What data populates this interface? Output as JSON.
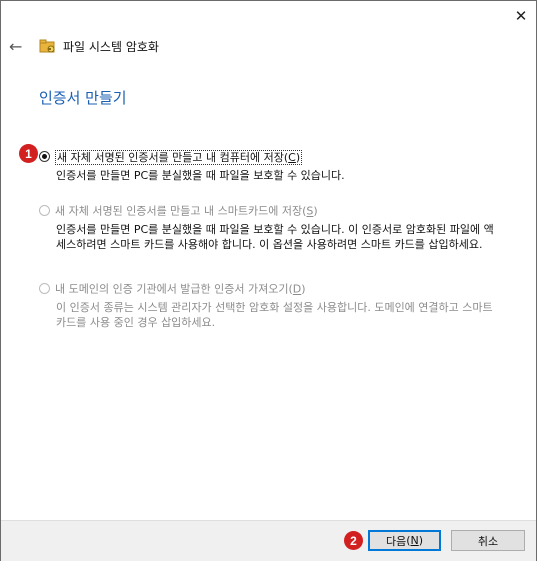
{
  "window": {
    "title": "파일 시스템 암호화"
  },
  "header": {
    "page_heading": "인증서 만들기"
  },
  "options": [
    {
      "label": "새 자체 서명된 인증서를 만들고 내 컴퓨터에 저장",
      "mnemonic": "C",
      "description": "인증서를 만들면 PC를 분실했을 때 파일을 보호할 수 있습니다.",
      "selected": true,
      "enabled": true
    },
    {
      "label": "새 자체 서명된 인증서를 만들고 내 스마트카드에 저장",
      "mnemonic": "S",
      "description": "인증서를 만들면 PC를 분실했을 때 파일을 보호할 수 있습니다. 이 인증서로 암호화된 파일에 액세스하려면 스마트 카드를 사용해야 합니다. 이 옵션을 사용하려면 스마트 카드를 삽입하세요.",
      "selected": false,
      "enabled": false
    },
    {
      "label": "내 도메인의 인증 기관에서 발급한 인증서 가져오기",
      "mnemonic": "D",
      "description": "이 인증서 종류는 시스템 관리자가 선택한 암호화 설정을 사용합니다. 도메인에 연결하고 스마트 카드를 사용 중인 경우 삽입하세요.",
      "selected": false,
      "enabled": false
    }
  ],
  "annotations": {
    "badge1": "1",
    "badge2": "2"
  },
  "footer": {
    "next_label": "다음",
    "next_mnemonic": "N",
    "cancel_label": "취소"
  },
  "colors": {
    "heading": "#1a5fb4",
    "badge": "#d21f1f",
    "primary_border": "#0078d7"
  }
}
